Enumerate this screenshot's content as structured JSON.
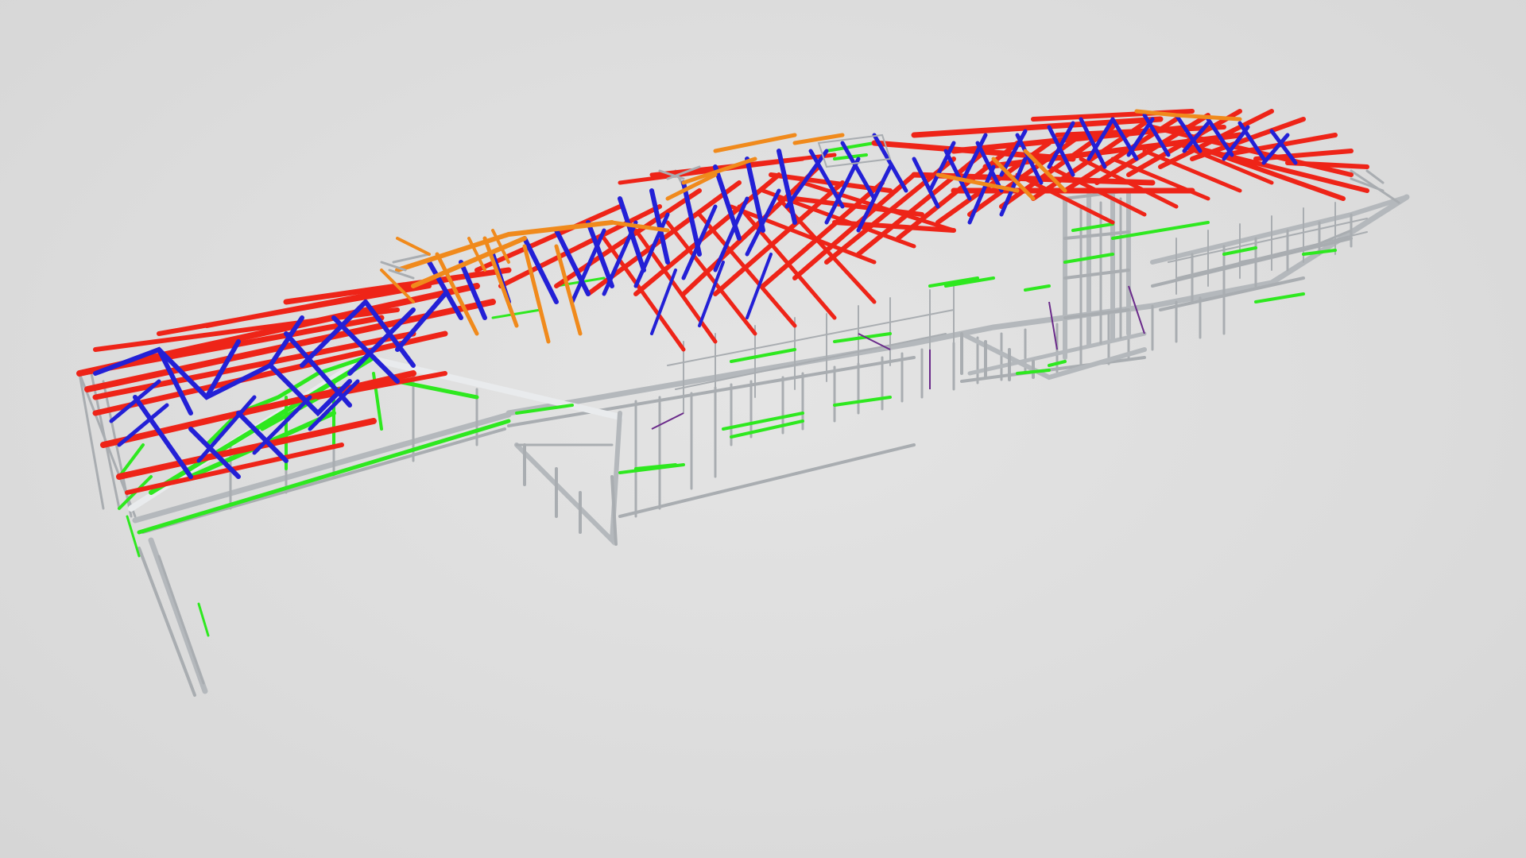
{
  "viewer": {
    "background_color": "#dcdcdc"
  },
  "model": {
    "member_colors": {
      "wall_frame": "#a9adb1",
      "noggings": "#2ee81f",
      "truss_chords": "#ee2418",
      "truss_webs": "#2320d6",
      "hip_members": "#f08a1c",
      "bracing": "#6a2a8a"
    }
  }
}
